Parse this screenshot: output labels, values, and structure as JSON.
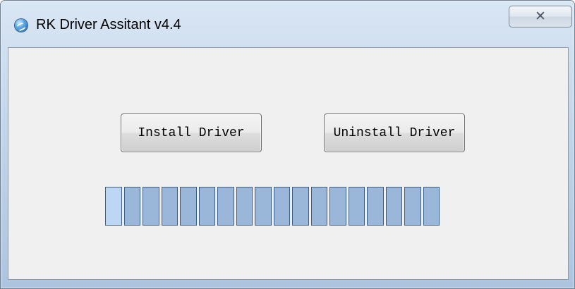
{
  "window": {
    "title": "RK Driver Assitant v4.4",
    "app_icon": "rockusb-icon",
    "close_icon": "close-icon",
    "close_glyph": "✕"
  },
  "buttons": {
    "install_label": "Install Driver",
    "uninstall_label": "Uninstall Driver"
  },
  "progress": {
    "segment_count": 18,
    "active_segments": 1,
    "active_color": "#bcd6f3",
    "inactive_color": "#9ab7da"
  }
}
